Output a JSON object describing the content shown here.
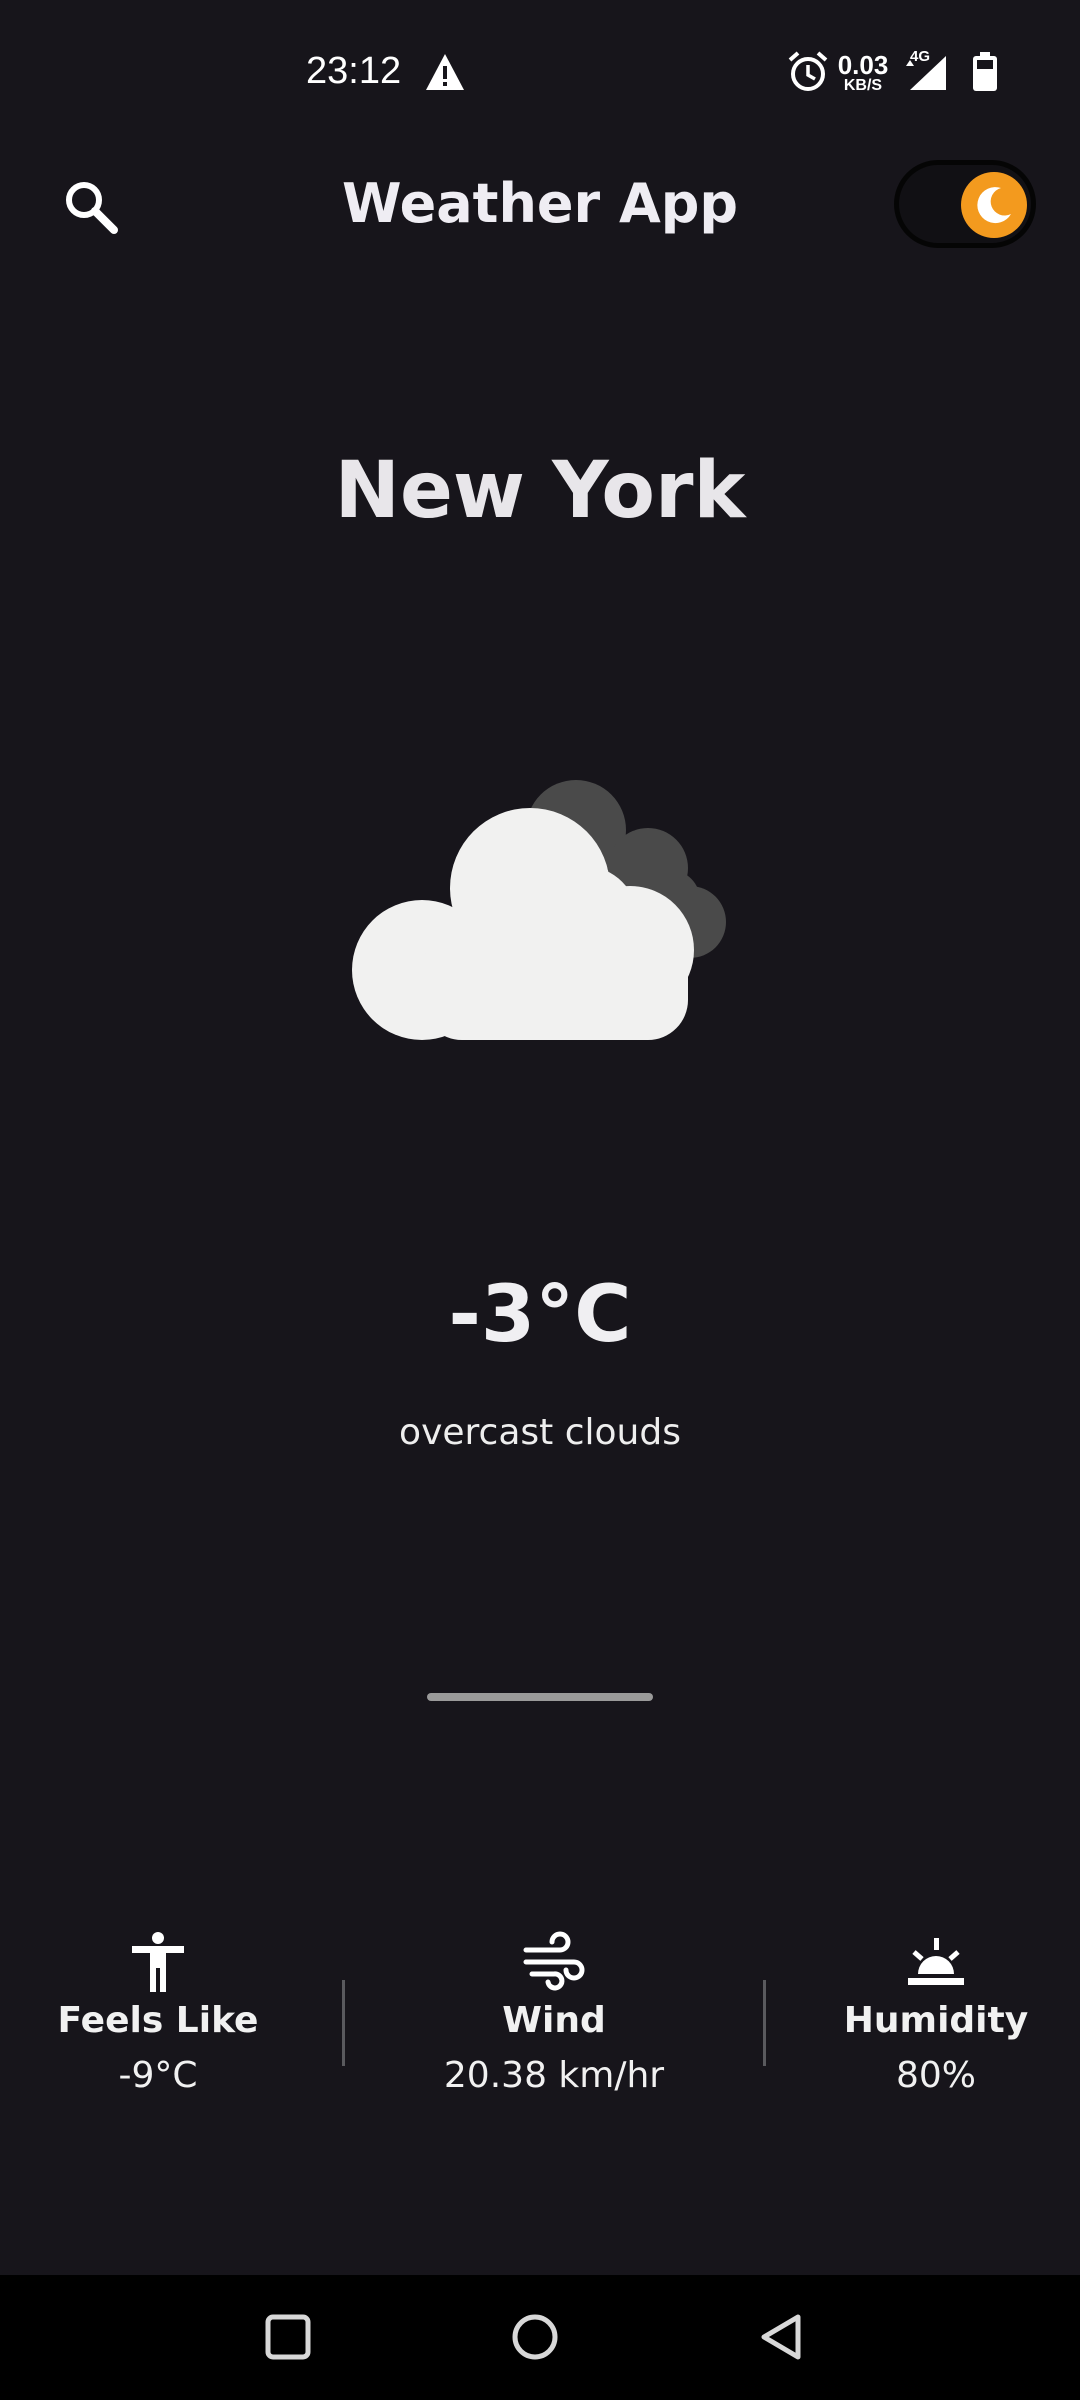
{
  "status_bar": {
    "time": "23:12",
    "speed_value": "0.03",
    "speed_unit": "KB/S",
    "network": "4G",
    "icons": [
      "warning-icon",
      "alarm-icon",
      "signal-icon",
      "battery-icon"
    ]
  },
  "header": {
    "title": "Weather App",
    "search_icon": "search-icon",
    "theme_toggle": {
      "mode": "dark",
      "icon": "moon-icon",
      "accent": "#f39a1e"
    }
  },
  "weather": {
    "city": "New York",
    "icon": "overcast-clouds-icon",
    "temperature": "-3°C",
    "description": "overcast clouds"
  },
  "stats": [
    {
      "icon": "person-icon",
      "label": "Feels Like",
      "value": "-9°C"
    },
    {
      "icon": "wind-icon",
      "label": "Wind",
      "value": "20.38 km/hr"
    },
    {
      "icon": "sunrise-icon",
      "label": "Humidity",
      "value": "80%"
    }
  ],
  "colors": {
    "background": "#17151b",
    "text": "#eeeeee",
    "accent": "#f39a1e",
    "navbar": "#000000"
  }
}
